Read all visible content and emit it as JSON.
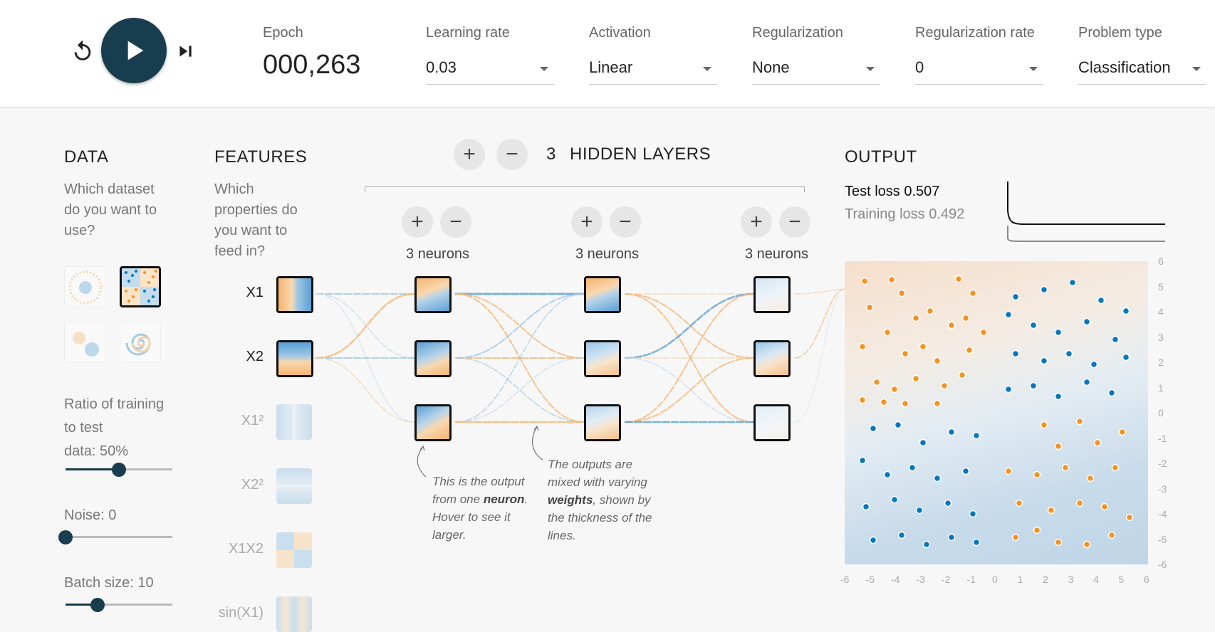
{
  "controls": {
    "epoch_label": "Epoch",
    "epoch_value": "000,263",
    "learning_rate": {
      "label": "Learning rate",
      "value": "0.03"
    },
    "activation": {
      "label": "Activation",
      "value": "Linear"
    },
    "regularization": {
      "label": "Regularization",
      "value": "None"
    },
    "regularization_rate": {
      "label": "Regularization rate",
      "value": "0"
    },
    "problem_type": {
      "label": "Problem type",
      "value": "Classification"
    }
  },
  "data_panel": {
    "title": "DATA",
    "question_lines": [
      "Which dataset",
      "do you want to",
      "use?"
    ],
    "selected_dataset": "xor",
    "ratio_label_lines": [
      "Ratio of training",
      "to test"
    ],
    "ratio_value_label": "data:  50%",
    "ratio_value": 0.5,
    "noise_label": "Noise:  0",
    "noise_value": 0,
    "batch_label": "Batch size:  10",
    "batch_value": 0.3
  },
  "features_panel": {
    "title": "FEATURES",
    "question_lines": [
      "Which",
      "properties do",
      "you want to",
      "feed in?"
    ],
    "features": [
      "X1",
      "X2",
      "X1²",
      "X2²",
      "X1X2",
      "sin(X1)"
    ]
  },
  "network": {
    "hidden_layers_count": "3",
    "hidden_layers_label": "HIDDEN LAYERS",
    "add_icon": "+",
    "remove_icon": "−",
    "layers": [
      {
        "neurons_label": "3 neurons"
      },
      {
        "neurons_label": "3 neurons"
      },
      {
        "neurons_label": "3 neurons"
      }
    ],
    "note_neuron": {
      "pre": "This is the output from one ",
      "bold": "neuron",
      "post": ". Hover to see it larger."
    },
    "note_weights": {
      "pre": "The outputs are mixed with varying ",
      "bold": "weights",
      "post": ", shown by the thickness of the lines."
    }
  },
  "output_panel": {
    "title": "OUTPUT",
    "test_loss_label": "Test loss 0.507",
    "training_loss_label": "Training loss 0.492",
    "x_ticks": [
      "-6",
      "-5",
      "-4",
      "-3",
      "-2",
      "-1",
      "0",
      "1",
      "2",
      "3",
      "4",
      "5",
      "6"
    ],
    "y_ticks": [
      "6",
      "5",
      "4",
      "3",
      "2",
      "1",
      "0",
      "-1",
      "-2",
      "-3",
      "-4",
      "-5",
      "-6"
    ]
  },
  "colors": {
    "orange": "#f59322",
    "blue": "#0877bd",
    "accent_dark": "#183d4e"
  }
}
